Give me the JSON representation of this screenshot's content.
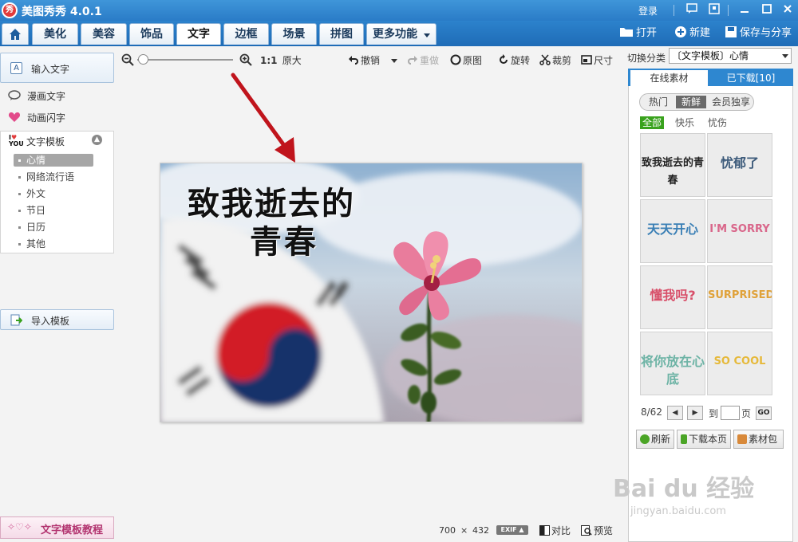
{
  "app": {
    "logo_char": "秀",
    "title": "美图秀秀 4.0.1",
    "login": "登录"
  },
  "nav": {
    "tabs": [
      "美化",
      "美容",
      "饰品",
      "文字",
      "边框",
      "场景",
      "拼图",
      "更多功能"
    ],
    "active": "文字",
    "actions": [
      "打开",
      "新建",
      "保存与分享"
    ]
  },
  "left": {
    "input_text": "输入文字",
    "comic_text": "漫画文字",
    "animated_text": "动画闪字",
    "template": {
      "title": "文字模板",
      "items": [
        "心情",
        "网络流行语",
        "外文",
        "节日",
        "日历",
        "其他"
      ],
      "active": "心情"
    },
    "import_template": "导入模板",
    "tutorial": "文字模板教程"
  },
  "toolbar": {
    "zoom_ratio": "1:1",
    "original_size": "原大",
    "undo": "撤销",
    "redo": "重做",
    "original": "原图",
    "rotate": "旋转",
    "crop": "裁剪",
    "resize": "尺寸"
  },
  "canvas": {
    "caption_line1": "致我逝去的",
    "caption_line2": "青春"
  },
  "status": {
    "width": "700",
    "times": "×",
    "height": "432",
    "exif": "EXIF",
    "compare": "对比",
    "preview": "预览"
  },
  "right": {
    "category_label": "切换分类",
    "category_value": "〔文字模板〕心情",
    "tabs": [
      "在线素材",
      "已下载[10]"
    ],
    "subtabs": [
      "热门",
      "新鲜",
      "会员独享"
    ],
    "subtab_active": "新鲜",
    "filters": [
      "全部",
      "快乐",
      "忧伤"
    ],
    "filter_active": "全部",
    "thumbs": [
      {
        "text": "致我逝去的青春",
        "color": "#222222"
      },
      {
        "text": "忧郁了",
        "color": "#3c5a7a"
      },
      {
        "text": "天天开心",
        "color": "#3a7fb5"
      },
      {
        "text": "I'M SORRY",
        "color": "#d9668a"
      },
      {
        "text": "懂我吗?",
        "color": "#d8506a"
      },
      {
        "text": "SURPRISED",
        "color": "#e0a23a"
      },
      {
        "text": "将你放在心底",
        "color": "#6db3a5"
      },
      {
        "text": "SO COOL",
        "color": "#e6b93a"
      }
    ],
    "pager": {
      "page": "8/62",
      "goto": "到",
      "page_unit": "页",
      "go": "GO"
    },
    "buttons": [
      "刷新",
      "下载本页",
      "素材包"
    ]
  },
  "watermark": {
    "brand": "Bai du 经验",
    "url": "jingyan.baidu.com"
  },
  "colors": {
    "accent": "#2a7cc7",
    "active_filter": "#39a21d",
    "tutorial": "#b2336f"
  }
}
